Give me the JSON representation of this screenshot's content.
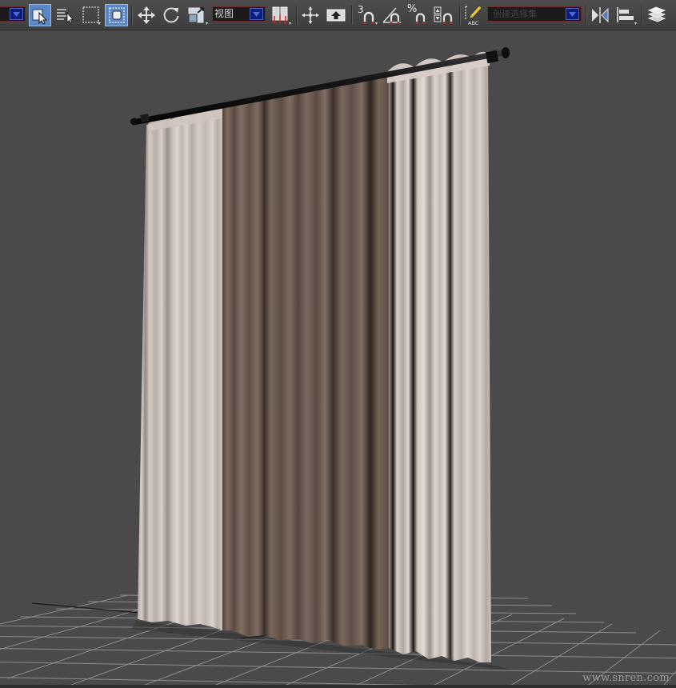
{
  "toolbar": {
    "selection_filter": {
      "value": ""
    },
    "reference_coordinate": {
      "value": "视图"
    },
    "named_selection_set": {
      "value": "创建选择集"
    },
    "snap_toggle_label": "3",
    "snap_mode_label": "%"
  },
  "viewport": {
    "watermark": "www.snren.com"
  },
  "colors": {
    "accent_active": "#5b86c4",
    "viewport_bg": "#4a4a4a",
    "grid_line": "#8c8c8c",
    "curtain_light": "#cfc4bd",
    "curtain_dark": "#6b5a51",
    "rod": "#111111"
  }
}
